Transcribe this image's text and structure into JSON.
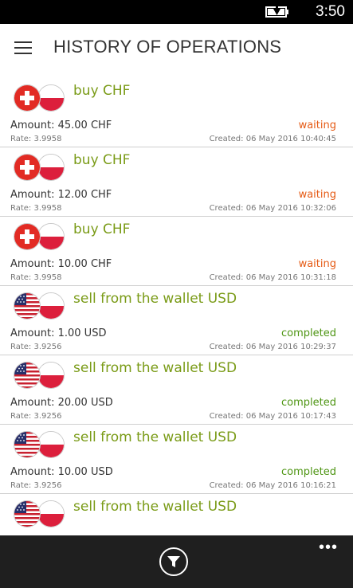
{
  "status_bar": {
    "time": "3:50",
    "battery_icon": "battery-charging-icon"
  },
  "header": {
    "title": "HISTORY OF OPERATIONS",
    "menu_icon": "hamburger-icon"
  },
  "operations": [
    {
      "title": "buy CHF",
      "flag_left": "switzerland-flag-icon",
      "flag_right": "poland-flag-icon",
      "amount": "Amount: 45.00 CHF",
      "status": "waiting",
      "rate": "Rate: 3.9958",
      "created": "Created:  06 May 2016 10:40:45"
    },
    {
      "title": "buy CHF",
      "flag_left": "switzerland-flag-icon",
      "flag_right": "poland-flag-icon",
      "amount": "Amount: 12.00 CHF",
      "status": "waiting",
      "rate": "Rate: 3.9958",
      "created": "Created:  06 May 2016 10:32:06"
    },
    {
      "title": "buy CHF",
      "flag_left": "switzerland-flag-icon",
      "flag_right": "poland-flag-icon",
      "amount": "Amount: 10.00 CHF",
      "status": "waiting",
      "rate": "Rate: 3.9958",
      "created": "Created:  06 May 2016 10:31:18"
    },
    {
      "title": "sell from the wallet USD",
      "flag_left": "usa-flag-icon",
      "flag_right": "poland-flag-icon",
      "amount": "Amount: 1.00 USD",
      "status": "completed",
      "rate": "Rate: 3.9256",
      "created": "Created:  06 May 2016 10:29:37"
    },
    {
      "title": "sell from the wallet USD",
      "flag_left": "usa-flag-icon",
      "flag_right": "poland-flag-icon",
      "amount": "Amount: 20.00 USD",
      "status": "completed",
      "rate": "Rate: 3.9256",
      "created": "Created:  06 May 2016 10:17:43"
    },
    {
      "title": "sell from the wallet USD",
      "flag_left": "usa-flag-icon",
      "flag_right": "poland-flag-icon",
      "amount": "Amount: 10.00 USD",
      "status": "completed",
      "rate": "Rate: 3.9256",
      "created": "Created:  06 May 2016 10:16:21"
    },
    {
      "title": "sell from the wallet USD",
      "flag_left": "usa-flag-icon",
      "flag_right": "poland-flag-icon",
      "amount": "",
      "status": "",
      "rate": "",
      "created": ""
    }
  ],
  "app_bar": {
    "more_label": "•••",
    "filter_icon": "filter-icon"
  },
  "colors": {
    "title_green": "#7a9b17",
    "waiting": "#e55a14",
    "completed": "#4e9513",
    "app_bar": "#1f1f1f"
  }
}
